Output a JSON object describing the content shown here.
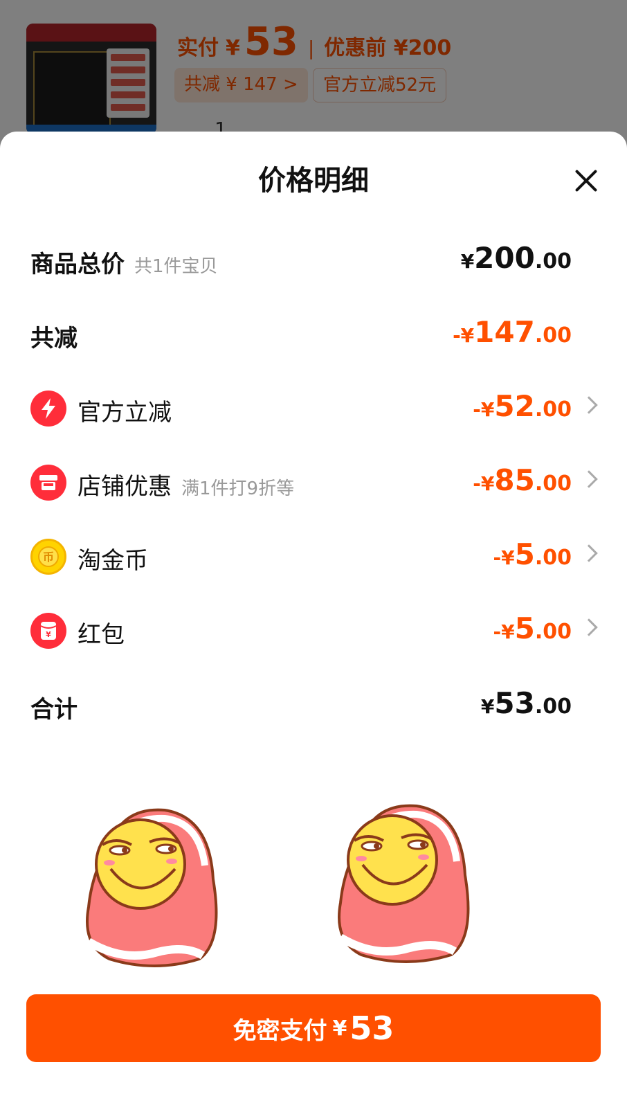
{
  "background_order": {
    "pay_label": "实付",
    "pay_currency": "¥",
    "pay_amount": "53",
    "before_label": "优惠前 ¥200",
    "discount_chip": "共减 ¥ 147 >",
    "official_chip": "官方立减52元",
    "quantity": "1"
  },
  "sheet": {
    "title": "价格明细",
    "rows": [
      {
        "label": "商品总价",
        "sub": "共1件宝贝",
        "currency": "¥",
        "int": "200",
        "dec": ".00",
        "sign": ""
      },
      {
        "label": "共减",
        "currency": "-¥",
        "int": "147",
        "dec": ".00"
      },
      {
        "label": "官方立减",
        "icon": "lightning-icon",
        "currency": "-¥",
        "int": "52",
        "dec": ".00"
      },
      {
        "label": "店铺优惠",
        "sub": "满1件打9折等",
        "icon": "shop-icon",
        "currency": "-¥",
        "int": "85",
        "dec": ".00"
      },
      {
        "label": "淘金币",
        "icon": "gold-coin-icon",
        "currency": "-¥",
        "int": "5",
        "dec": ".00"
      },
      {
        "label": "红包",
        "icon": "red-packet-icon",
        "currency": "-¥",
        "int": "5",
        "dec": ".00"
      },
      {
        "label": "合计",
        "currency": "¥",
        "int": "53",
        "dec": ".00"
      }
    ]
  },
  "pay_button": {
    "label": "免密支付",
    "currency": "¥",
    "amount": "53"
  },
  "colors": {
    "accent": "#ff5000",
    "icon_red": "#ff2d3a",
    "coin_yellow": "#ffd300"
  }
}
